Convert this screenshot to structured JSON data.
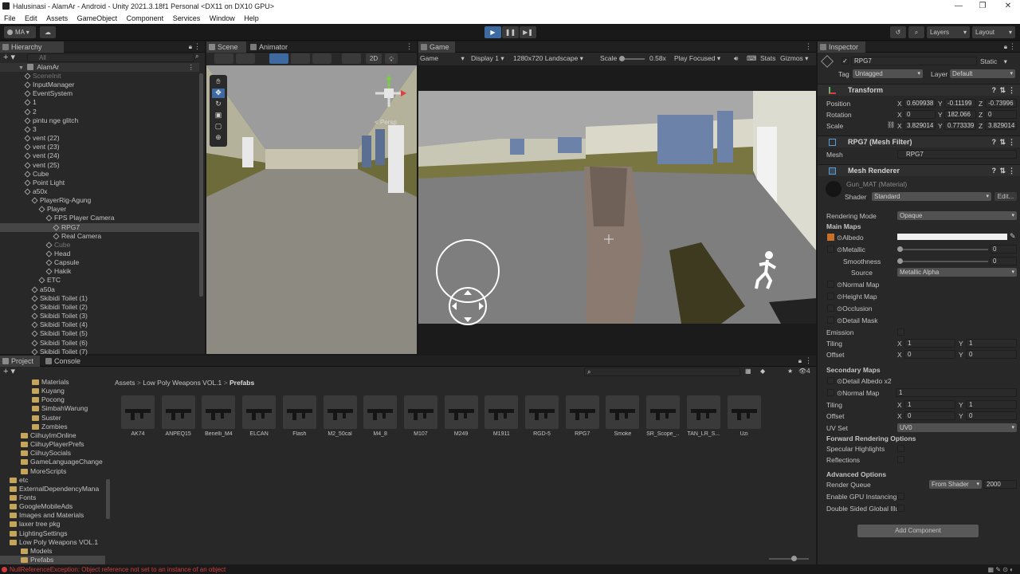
{
  "window": {
    "title": "Halusinasi - AlamAr - Android - Unity 2021.3.18f1 Personal <DX11 on DX10 GPU>",
    "minimize": "—",
    "maximize": "❐",
    "close": "✕"
  },
  "menu": [
    "File",
    "Edit",
    "Assets",
    "GameObject",
    "Component",
    "Services",
    "Window",
    "Help"
  ],
  "toolbar": {
    "account": "MA",
    "layers": "Layers",
    "layout": "Layout"
  },
  "hierarchy": {
    "tab": "Hierarchy",
    "search_placeholder": "All",
    "scene": "AlamAr",
    "items": [
      {
        "label": "SceneInit",
        "depth": 1,
        "dim": true
      },
      {
        "label": "InputManager",
        "depth": 1
      },
      {
        "label": "EventSystem",
        "depth": 1
      },
      {
        "label": "1",
        "depth": 1
      },
      {
        "label": "2",
        "depth": 1
      },
      {
        "label": "pintu nge glitch",
        "depth": 1
      },
      {
        "label": "3",
        "depth": 1
      },
      {
        "label": "vent (22)",
        "depth": 1
      },
      {
        "label": "vent (23)",
        "depth": 1
      },
      {
        "label": "vent (24)",
        "depth": 1
      },
      {
        "label": "vent (25)",
        "depth": 1
      },
      {
        "label": "Cube",
        "depth": 1
      },
      {
        "label": "Point Light",
        "depth": 1
      },
      {
        "label": "a50x",
        "depth": 1
      },
      {
        "label": "PlayerRig-Agung",
        "depth": 2
      },
      {
        "label": "Player",
        "depth": 3
      },
      {
        "label": "FPS Player Camera",
        "depth": 4
      },
      {
        "label": "RPG7",
        "depth": 5,
        "selected": true
      },
      {
        "label": "Real Camera",
        "depth": 5
      },
      {
        "label": "Cube",
        "depth": 4,
        "dim": true
      },
      {
        "label": "Head",
        "depth": 4
      },
      {
        "label": "Capsule",
        "depth": 4
      },
      {
        "label": "Hakik",
        "depth": 4
      },
      {
        "label": "ETC",
        "depth": 3
      },
      {
        "label": "a50a",
        "depth": 2
      },
      {
        "label": "Skibidi Toilet (1)",
        "depth": 2
      },
      {
        "label": "Skibidi Toilet (2)",
        "depth": 2
      },
      {
        "label": "Skibidi Toilet (3)",
        "depth": 2
      },
      {
        "label": "Skibidi Toilet (4)",
        "depth": 2
      },
      {
        "label": "Skibidi Toilet (5)",
        "depth": 2
      },
      {
        "label": "Skibidi Toilet (6)",
        "depth": 2
      },
      {
        "label": "Skibidi Toilet (7)",
        "depth": 2
      }
    ]
  },
  "scene": {
    "tab_scene": "Scene",
    "tab_animator": "Animator",
    "btn_2d": "2D",
    "persp": "< Persp"
  },
  "game": {
    "tab": "Game",
    "mode": "Game",
    "display": "Display 1",
    "resolution": "1280x720 Landscape",
    "scale_label": "Scale",
    "scale_value": "0.58x",
    "play_focused": "Play Focused",
    "stats": "Stats",
    "gizmos": "Gizmos"
  },
  "project": {
    "tab_project": "Project",
    "tab_console": "Console",
    "badge": "4",
    "breadcrumb": [
      "Assets",
      "Low Poly Weapons VOL.1",
      "Prefabs"
    ],
    "tree": [
      {
        "label": "Materials",
        "depth": 3
      },
      {
        "label": "Kuyang",
        "depth": 3
      },
      {
        "label": "Pocong",
        "depth": 3
      },
      {
        "label": "SimbahWarung",
        "depth": 3
      },
      {
        "label": "Suster",
        "depth": 3
      },
      {
        "label": "Zombies",
        "depth": 3
      },
      {
        "label": "CiihuyImOnline",
        "depth": 2
      },
      {
        "label": "CiihuyPlayerPrefs",
        "depth": 2
      },
      {
        "label": "CiihuySocials",
        "depth": 2
      },
      {
        "label": "GameLanguageChange",
        "depth": 2
      },
      {
        "label": "MoreScripts",
        "depth": 2
      },
      {
        "label": "etc",
        "depth": 1
      },
      {
        "label": "ExternalDependencyMana",
        "depth": 1
      },
      {
        "label": "Fonts",
        "depth": 1
      },
      {
        "label": "GoogleMobileAds",
        "depth": 1
      },
      {
        "label": "Images and Materials",
        "depth": 1
      },
      {
        "label": "laxer tree pkg",
        "depth": 1
      },
      {
        "label": "LightingSettings",
        "depth": 1
      },
      {
        "label": "Low Poly Weapons VOL.1",
        "depth": 1
      },
      {
        "label": "Models",
        "depth": 2
      },
      {
        "label": "Prefabs",
        "depth": 2,
        "selected": true
      }
    ],
    "assets": [
      "AK74",
      "ANPEQ15",
      "Benelli_M4",
      "ELCAN",
      "Flash",
      "M2_50cal",
      "M4_8",
      "M107",
      "M249",
      "M1911",
      "RGD-5",
      "RPG7",
      "Smoke",
      "SR_Scope_...",
      "TAN_LR_S...",
      "Uzi"
    ]
  },
  "inspector": {
    "tab": "Inspector",
    "object_name": "RPG7",
    "static": "Static",
    "tag_label": "Tag",
    "tag_value": "Untagged",
    "layer_label": "Layer",
    "layer_value": "Default",
    "transform": {
      "title": "Transform",
      "position_label": "Position",
      "rotation_label": "Rotation",
      "scale_label": "Scale",
      "position": [
        "0.609938",
        "-0.11199",
        "-0.73996"
      ],
      "rotation": [
        "0",
        "182.066",
        "0"
      ],
      "scale": [
        "3.829014",
        "0.773339",
        "3.829014"
      ]
    },
    "mesh_filter": {
      "title": "RPG7 (Mesh Filter)",
      "mesh_label": "Mesh",
      "mesh_value": "RPG7"
    },
    "mesh_renderer": {
      "title": "Mesh Renderer"
    },
    "material": {
      "name": "Gun_MAT (Material)",
      "shader_label": "Shader",
      "shader_value": "Standard",
      "edit": "Edit..."
    },
    "rendering_mode_label": "Rendering Mode",
    "rendering_mode_value": "Opaque",
    "main_maps": "Main Maps",
    "albedo": "Albedo",
    "metallic": "Metallic",
    "metallic_value": "0",
    "smoothness": "Smoothness",
    "smoothness_value": "0",
    "source_label": "Source",
    "source_value": "Metallic Alpha",
    "normal_map": "Normal Map",
    "height_map": "Height Map",
    "occlusion": "Occlusion",
    "detail_mask": "Detail Mask",
    "emission": "Emission",
    "tiling": "Tiling",
    "offset": "Offset",
    "tiling_values": [
      "1",
      "1"
    ],
    "offset_values": [
      "0",
      "0"
    ],
    "secondary_maps": "Secondary Maps",
    "detail_albedo": "Detail Albedo x2",
    "sec_normal_map": "Normal Map",
    "sec_normal_value": "1",
    "sec_tiling_values": [
      "1",
      "1"
    ],
    "sec_offset_values": [
      "0",
      "0"
    ],
    "uv_set_label": "UV Set",
    "uv_set_value": "UV0",
    "forward_options": "Forward Rendering Options",
    "specular": "Specular Highlights",
    "reflections": "Reflections",
    "advanced": "Advanced Options",
    "render_queue_label": "Render Queue",
    "render_queue_mode": "From Shader",
    "render_queue_value": "2000",
    "gpu_instancing": "Enable GPU Instancing",
    "double_sided": "Double Sided Global Illu",
    "add_component": "Add Component"
  },
  "status": "NullReferenceException: Object reference not set to an instance of an object"
}
